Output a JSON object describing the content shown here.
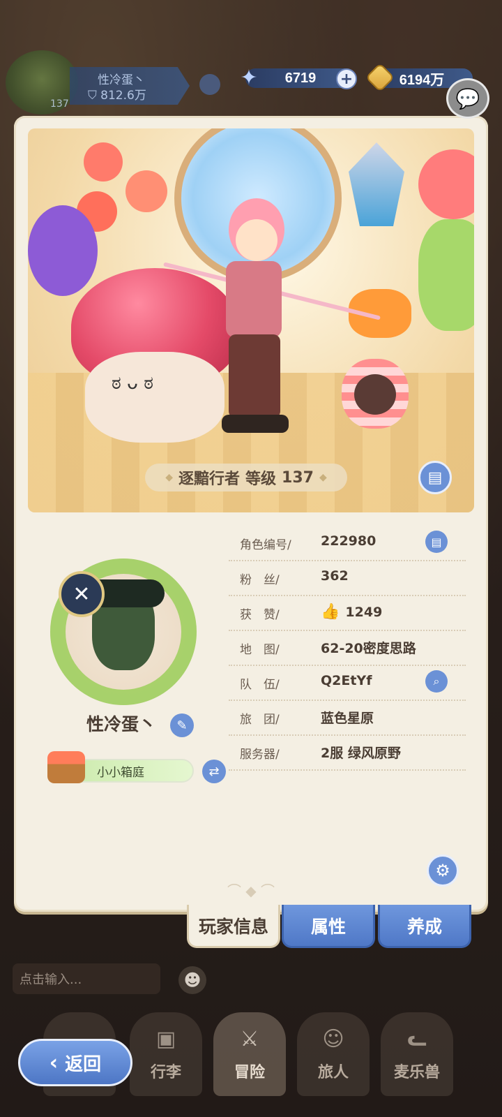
{
  "hud": {
    "player_name": "性冷蛋丶",
    "power": "812.6万",
    "level": "137",
    "stars": "6719",
    "gold": "6194万"
  },
  "hero": {
    "title": "逐黯行者",
    "level_label": "等级",
    "level": "137"
  },
  "profile": {
    "name": "性冷蛋丶",
    "home_name": "小小箱庭",
    "rows": [
      {
        "label": "角色编号/",
        "value": "222980"
      },
      {
        "label": "粉　丝/",
        "value": "362"
      },
      {
        "label": "获　赞/",
        "value": "1249"
      },
      {
        "label": "地　图/",
        "value": "62-20密度思路"
      },
      {
        "label": "队　伍/",
        "value": "Q2EtYf"
      },
      {
        "label": "旅　团/",
        "value": "蓝色星原"
      },
      {
        "label": "服务器/",
        "value": "2服  绿风原野"
      }
    ]
  },
  "tabs": {
    "player_info": "玩家信息",
    "attributes": "属性",
    "development": "养成"
  },
  "chat": {
    "placeholder": "点击输入..."
  },
  "nav": {
    "back": "返回",
    "items": [
      "",
      "行李",
      "冒险",
      "旅人",
      "麦乐兽"
    ]
  },
  "icons": {
    "star": "star-icon",
    "coin": "coin-icon",
    "plus": "plus-icon",
    "chat": "chat-icon",
    "copy": "copy-icon",
    "search": "search-icon",
    "edit": "pencil-icon",
    "swap": "swap-icon",
    "settings": "gear-icon",
    "like": "thumbs-up-icon"
  },
  "colors": {
    "accent_blue": "#6b91d6",
    "panel_bg": "#f4efe3",
    "text_dark": "#4a3d33"
  }
}
